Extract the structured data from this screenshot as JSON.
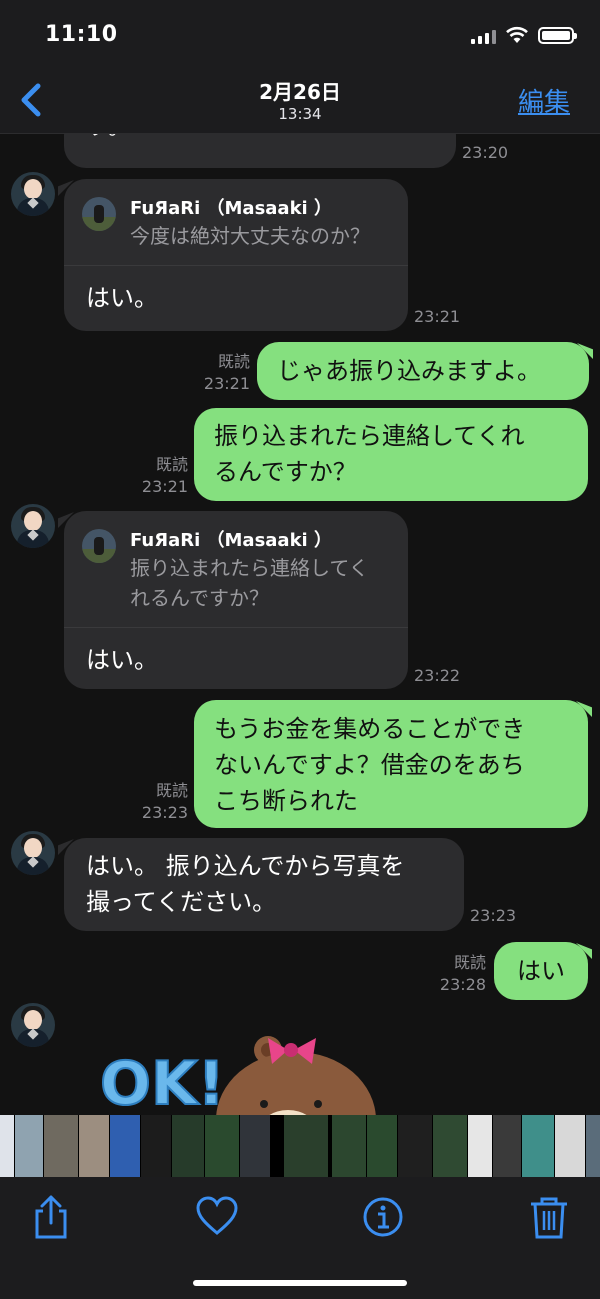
{
  "status": {
    "time": "11:10"
  },
  "header": {
    "date": "2月26日",
    "time": "13:34",
    "edit_label": "編集"
  },
  "messages": {
    "m0": {
      "text": "す。",
      "time": "23:20"
    },
    "m1": {
      "reply_name": "FuЯaRi （Masaaki ）",
      "reply_text": "今度は絶対大丈夫なのか？",
      "text": "はい。",
      "time": "23:21"
    },
    "m2": {
      "read": "既読",
      "time": "23:21",
      "text": "じゃあ振り込みますよ。"
    },
    "m3": {
      "read": "既読",
      "time": "23:21",
      "line1": "振り込まれたら連絡してくれ",
      "line2": "るんですか？"
    },
    "m4": {
      "reply_name": "FuЯaRi （Masaaki ）",
      "reply_line1": "振り込まれたら連絡してく",
      "reply_line2": "れるんですか？",
      "text": "はい。",
      "time": "23:22"
    },
    "m5": {
      "read": "既読",
      "time": "23:23",
      "line1": "もうお金を集めることができ",
      "line2": "ないんですよ？借金のをあち",
      "line3": "こち断られた"
    },
    "m6": {
      "line1": "はい。 振り込んでから写真を",
      "line2": "撮ってください。",
      "time": "23:23"
    },
    "m7": {
      "read": "既読",
      "time": "23:28",
      "text": "はい"
    },
    "sticker": {
      "text": "OK!"
    }
  },
  "colors": {
    "accent": "#3b8ef0",
    "bubble_out": "#85e07f",
    "bubble_in": "#2c2c2e"
  },
  "toolbar": {
    "icons": [
      "share-icon",
      "heart-icon",
      "info-icon",
      "trash-icon"
    ]
  }
}
